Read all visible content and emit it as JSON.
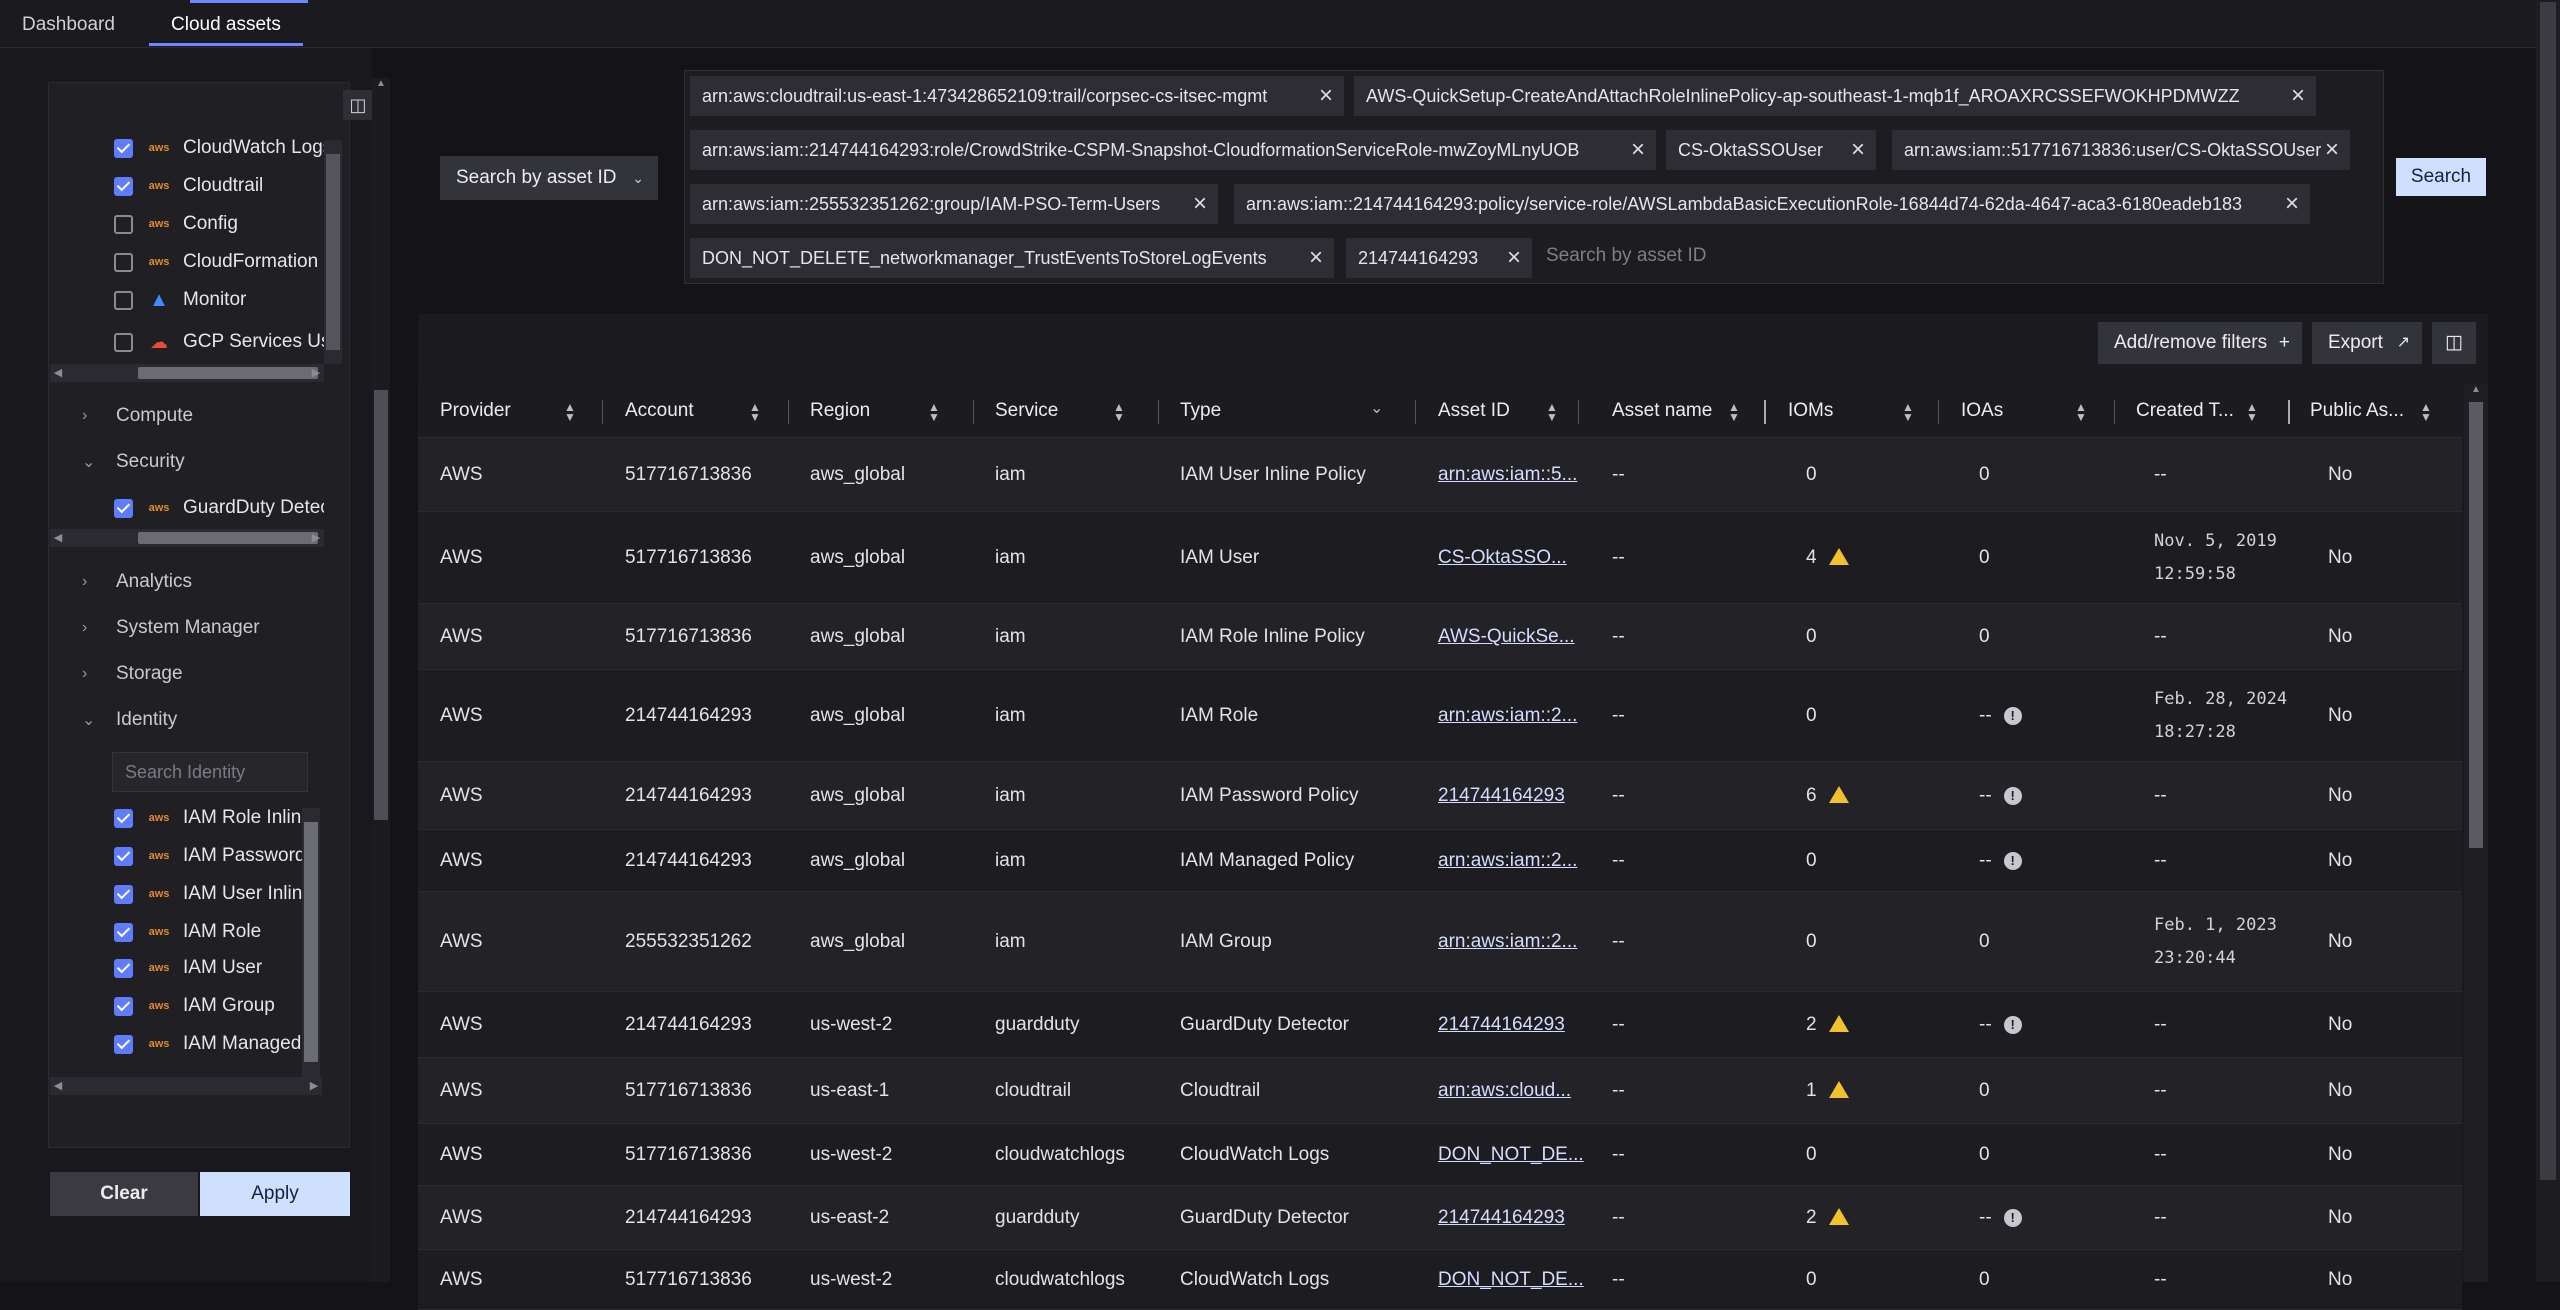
{
  "tabs": [
    {
      "label": "Dashboard"
    },
    {
      "label": "Cloud assets"
    }
  ],
  "filters": {
    "services_top": [
      {
        "label": "CloudWatch Logs",
        "checked": true,
        "icon": "aws-icon"
      },
      {
        "label": "Cloudtrail",
        "checked": true,
        "icon": "aws-icon"
      },
      {
        "label": "Config",
        "checked": false,
        "icon": "aws-icon"
      },
      {
        "label": "CloudFormation",
        "checked": false,
        "icon": "aws-icon"
      },
      {
        "label": "Monitor",
        "checked": false,
        "icon": "azure-icon"
      },
      {
        "label": "GCP Services Usage",
        "checked": false,
        "icon": "gcp-icon"
      }
    ],
    "categories": {
      "compute": "Compute",
      "security": "Security",
      "analytics": "Analytics",
      "system_manager": "System Manager",
      "storage": "Storage",
      "identity": "Identity"
    },
    "security_items": [
      {
        "label": "GuardDuty Detector",
        "checked": true
      }
    ],
    "identity_search_placeholder": "Search Identity",
    "identity_items": [
      {
        "label": "IAM Role Inline Policy",
        "checked": true
      },
      {
        "label": "IAM Password Policy",
        "checked": true
      },
      {
        "label": "IAM User Inline Policy",
        "checked": true
      },
      {
        "label": "IAM Role",
        "checked": true
      },
      {
        "label": "IAM User",
        "checked": true
      },
      {
        "label": "IAM Group",
        "checked": true
      },
      {
        "label": "IAM Managed Policy",
        "checked": true
      }
    ],
    "clear_label": "Clear",
    "apply_label": "Apply"
  },
  "search": {
    "mode_label": "Search by asset ID",
    "placeholder": "Search by asset ID",
    "button_label": "Search",
    "chips": [
      "arn:aws:cloudtrail:us-east-1:473428652109:trail/corpsec-cs-itsec-mgmt",
      "AWS-QuickSetup-CreateAndAttachRoleInlinePolicy-ap-southeast-1-mqb1f_AROAXRCSSEFWOKHPDMWZZ",
      "arn:aws:iam::214744164293:role/CrowdStrike-CSPM-Snapshot-CloudformationServiceRole-mwZoyMLnyUOB",
      "CS-OktaSSOUser",
      "arn:aws:iam::517716713836:user/CS-OktaSSOUser",
      "arn:aws:iam::255532351262:group/IAM-PSO-Term-Users",
      "arn:aws:iam::214744164293:policy/service-role/AWSLambdaBasicExecutionRole-16844d74-62da-4647-aca3-6180eadeb183",
      "DON_NOT_DELETE_networkmanager_TrustEventsToStoreLogEvents",
      "214744164293"
    ]
  },
  "toolbar": {
    "add_remove_label": "Add/remove filters",
    "export_label": "Export"
  },
  "table": {
    "columns": [
      "Provider",
      "Account",
      "Region",
      "Service",
      "Type",
      "Asset ID",
      "Asset name",
      "IOMs",
      "IOAs",
      "Created T...",
      "Public As..."
    ],
    "rows": [
      {
        "provider": "AWS",
        "account": "517716713836",
        "region": "aws_global",
        "service": "iam",
        "type": "IAM User Inline Policy",
        "asset_id": "arn:aws:iam::5...",
        "asset_name": "--",
        "ioms": "0",
        "iom_warn": false,
        "ioas": "0",
        "ioa_info": false,
        "created": "--",
        "created2": "",
        "public": "No"
      },
      {
        "provider": "AWS",
        "account": "517716713836",
        "region": "aws_global",
        "service": "iam",
        "type": "IAM User",
        "asset_id": "CS-OktaSSO...",
        "asset_name": "--",
        "ioms": "4",
        "iom_warn": true,
        "ioas": "0",
        "ioa_info": false,
        "created": "Nov. 5, 2019",
        "created2": "12:59:58",
        "public": "No"
      },
      {
        "provider": "AWS",
        "account": "517716713836",
        "region": "aws_global",
        "service": "iam",
        "type": "IAM Role Inline Policy",
        "asset_id": "AWS-QuickSe...",
        "asset_name": "--",
        "ioms": "0",
        "iom_warn": false,
        "ioas": "0",
        "ioa_info": false,
        "created": "--",
        "created2": "",
        "public": "No"
      },
      {
        "provider": "AWS",
        "account": "214744164293",
        "region": "aws_global",
        "service": "iam",
        "type": "IAM Role",
        "asset_id": "arn:aws:iam::2...",
        "asset_name": "--",
        "ioms": "0",
        "iom_warn": false,
        "ioas": "--",
        "ioa_info": true,
        "created": "Feb. 28, 2024",
        "created2": "18:27:28",
        "public": "No"
      },
      {
        "provider": "AWS",
        "account": "214744164293",
        "region": "aws_global",
        "service": "iam",
        "type": "IAM Password Policy",
        "asset_id": "214744164293",
        "asset_name": "--",
        "ioms": "6",
        "iom_warn": true,
        "ioas": "--",
        "ioa_info": true,
        "created": "--",
        "created2": "",
        "public": "No"
      },
      {
        "provider": "AWS",
        "account": "214744164293",
        "region": "aws_global",
        "service": "iam",
        "type": "IAM Managed Policy",
        "asset_id": "arn:aws:iam::2...",
        "asset_name": "--",
        "ioms": "0",
        "iom_warn": false,
        "ioas": "--",
        "ioa_info": true,
        "created": "--",
        "created2": "",
        "public": "No"
      },
      {
        "provider": "AWS",
        "account": "255532351262",
        "region": "aws_global",
        "service": "iam",
        "type": "IAM Group",
        "asset_id": "arn:aws:iam::2...",
        "asset_name": "--",
        "ioms": "0",
        "iom_warn": false,
        "ioas": "0",
        "ioa_info": false,
        "created": "Feb. 1, 2023",
        "created2": "23:20:44",
        "public": "No"
      },
      {
        "provider": "AWS",
        "account": "214744164293",
        "region": "us-west-2",
        "service": "guardduty",
        "type": "GuardDuty Detector",
        "asset_id": "214744164293",
        "asset_name": "--",
        "ioms": "2",
        "iom_warn": true,
        "ioas": "--",
        "ioa_info": true,
        "created": "--",
        "created2": "",
        "public": "No"
      },
      {
        "provider": "AWS",
        "account": "517716713836",
        "region": "us-east-1",
        "service": "cloudtrail",
        "type": "Cloudtrail",
        "asset_id": "arn:aws:cloud...",
        "asset_name": "--",
        "ioms": "1",
        "iom_warn": true,
        "ioas": "0",
        "ioa_info": false,
        "created": "--",
        "created2": "",
        "public": "No"
      },
      {
        "provider": "AWS",
        "account": "517716713836",
        "region": "us-west-2",
        "service": "cloudwatchlogs",
        "type": "CloudWatch Logs",
        "asset_id": "DON_NOT_DE...",
        "asset_name": "--",
        "ioms": "0",
        "iom_warn": false,
        "ioas": "0",
        "ioa_info": false,
        "created": "--",
        "created2": "",
        "public": "No"
      },
      {
        "provider": "AWS",
        "account": "214744164293",
        "region": "us-east-2",
        "service": "guardduty",
        "type": "GuardDuty Detector",
        "asset_id": "214744164293",
        "asset_name": "--",
        "ioms": "2",
        "iom_warn": true,
        "ioas": "--",
        "ioa_info": true,
        "created": "--",
        "created2": "",
        "public": "No"
      },
      {
        "provider": "AWS",
        "account": "517716713836",
        "region": "us-west-2",
        "service": "cloudwatchlogs",
        "type": "CloudWatch Logs",
        "asset_id": "DON_NOT_DE...",
        "asset_name": "--",
        "ioms": "0",
        "iom_warn": false,
        "ioas": "0",
        "ioa_info": false,
        "created": "--",
        "created2": "",
        "public": "No"
      }
    ]
  },
  "colors": {
    "accent": "#6c87ff",
    "checkbox": "#5f7cff",
    "warning": "#f2c12e",
    "primary_button": "#cfe0ff"
  }
}
